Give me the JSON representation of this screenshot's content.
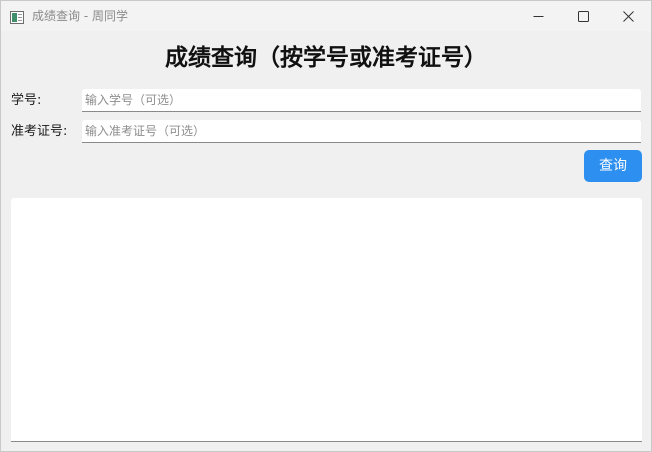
{
  "window": {
    "title": "成绩查询 - 周同学",
    "icons": {
      "app": "app-window-icon",
      "minimize": "minimize-icon",
      "maximize": "maximize-icon",
      "close": "close-icon"
    }
  },
  "main": {
    "heading": "成绩查询（按学号或准考证号）",
    "fields": [
      {
        "label": "学号:",
        "value": "",
        "placeholder": "输入学号（可选）"
      },
      {
        "label": "准考证号:",
        "value": "",
        "placeholder": "输入准考证号（可选）"
      }
    ],
    "query_button": "查询",
    "result_text": ""
  },
  "colors": {
    "accent": "#2d8ff0",
    "window_bg": "#f0f0f0",
    "input_bg": "#ffffff"
  }
}
